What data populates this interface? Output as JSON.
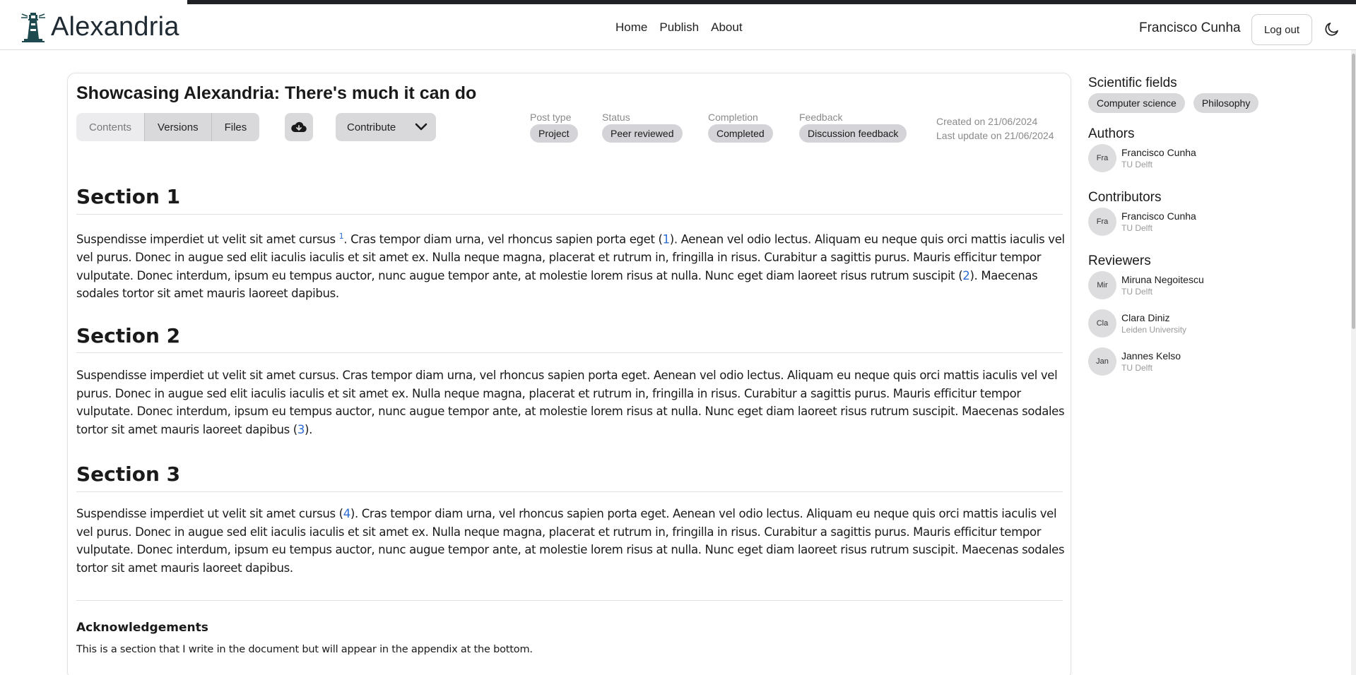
{
  "navbar": {
    "brand": "Alexandria",
    "links": [
      "Home",
      "Publish",
      "About"
    ],
    "user": "Francisco Cunha",
    "logout_label": "Log out",
    "theme_icon": "moon-icon",
    "logo_icon": "lighthouse-icon"
  },
  "post": {
    "title": "Showcasing Alexandria: There's much it can do",
    "tabs": [
      "Contents",
      "Versions",
      "Files"
    ],
    "active_tab": "Contents",
    "download_icon": "cloud-download-icon",
    "contribute_label": "Contribute",
    "meta": {
      "post_type_label": "Post type",
      "post_type": "Project",
      "status_label": "Status",
      "status": "Peer reviewed",
      "completion_label": "Completion",
      "completion": "Completed",
      "feedback_label": "Feedback",
      "feedback": "Discussion feedback"
    },
    "created": "Created on 21/06/2024",
    "updated": "Last update on 21/06/2024"
  },
  "content": {
    "s1_title": "Section 1",
    "s1_a": "Suspendisse imperdiet ut velit sit amet cursus ",
    "s1_sup": "1",
    "s1_b": ". Cras tempor diam urna, vel rhoncus sapien porta eget (",
    "s1_ref1": "1",
    "s1_c": "). Aenean vel odio lectus. Aliquam eu neque quis orci mattis iaculis vel vel purus. Donec in augue sed elit iaculis iaculis et sit amet ex. Nulla neque magna, placerat et rutrum in, fringilla in risus. Curabitur a sagittis purus. Mauris efficitur tempor vulputate. Donec interdum, ipsum eu tempus auctor, nunc augue tempor ante, at molestie lorem risus at nulla. Nunc eget diam laoreet risus rutrum suscipit (",
    "s1_ref2": "2",
    "s1_d": "). Maecenas sodales tortor sit amet mauris laoreet dapibus.",
    "s2_title": "Section 2",
    "s2_a": "Suspendisse imperdiet ut velit sit amet cursus. Cras tempor diam urna, vel rhoncus sapien porta eget. Aenean vel odio lectus. Aliquam eu neque quis orci mattis iaculis vel vel purus. Donec in augue sed elit iaculis iaculis et sit amet ex. Nulla neque magna, placerat et rutrum in, fringilla in risus. Curabitur a sagittis purus. Mauris efficitur tempor vulputate. Donec interdum, ipsum eu tempus auctor, nunc augue tempor ante, at molestie lorem risus at nulla. Nunc eget diam laoreet risus rutrum suscipit. Maecenas sodales tortor sit amet mauris laoreet dapibus (",
    "s2_ref": "3",
    "s2_b": ").",
    "s3_title": "Section 3",
    "s3_a": "Suspendisse imperdiet ut velit sit amet cursus (",
    "s3_ref": "4",
    "s3_b": "). Cras tempor diam urna, vel rhoncus sapien porta eget. Aenean vel odio lectus. Aliquam eu neque quis orci mattis iaculis vel vel purus. Donec in augue sed elit iaculis iaculis et sit amet ex. Nulla neque magna, placerat et rutrum in, fringilla in risus. Curabitur a sagittis purus. Mauris efficitur tempor vulputate. Donec interdum, ipsum eu tempus auctor, nunc augue tempor ante, at molestie lorem risus at nulla. Nunc eget diam laoreet risus rutrum suscipit. Maecenas sodales tortor sit amet mauris laoreet dapibus.",
    "ack_title": "Acknowledgements",
    "ack_text": "This is a section that I write in the document but will appear in the appendix at the bottom."
  },
  "sidebar": {
    "fields_title": "Scientific fields",
    "fields": [
      "Computer science",
      "Philosophy"
    ],
    "authors_title": "Authors",
    "authors": [
      {
        "initials": "Fra",
        "name": "Francisco Cunha",
        "affiliation": "TU Delft"
      }
    ],
    "contributors_title": "Contributors",
    "contributors": [
      {
        "initials": "Fra",
        "name": "Francisco Cunha",
        "affiliation": "TU Delft"
      }
    ],
    "reviewers_title": "Reviewers",
    "reviewers": [
      {
        "initials": "Mir",
        "name": "Miruna Negoitescu",
        "affiliation": "TU Delft"
      },
      {
        "initials": "Cla",
        "name": "Clara Diniz",
        "affiliation": "Leiden University"
      },
      {
        "initials": "Jan",
        "name": "Jannes Kelso",
        "affiliation": "TU Delft"
      }
    ]
  },
  "colors": {
    "link": "#2b6cd4",
    "badge": "#d4d4d8",
    "logo": "#1f4a4f"
  }
}
